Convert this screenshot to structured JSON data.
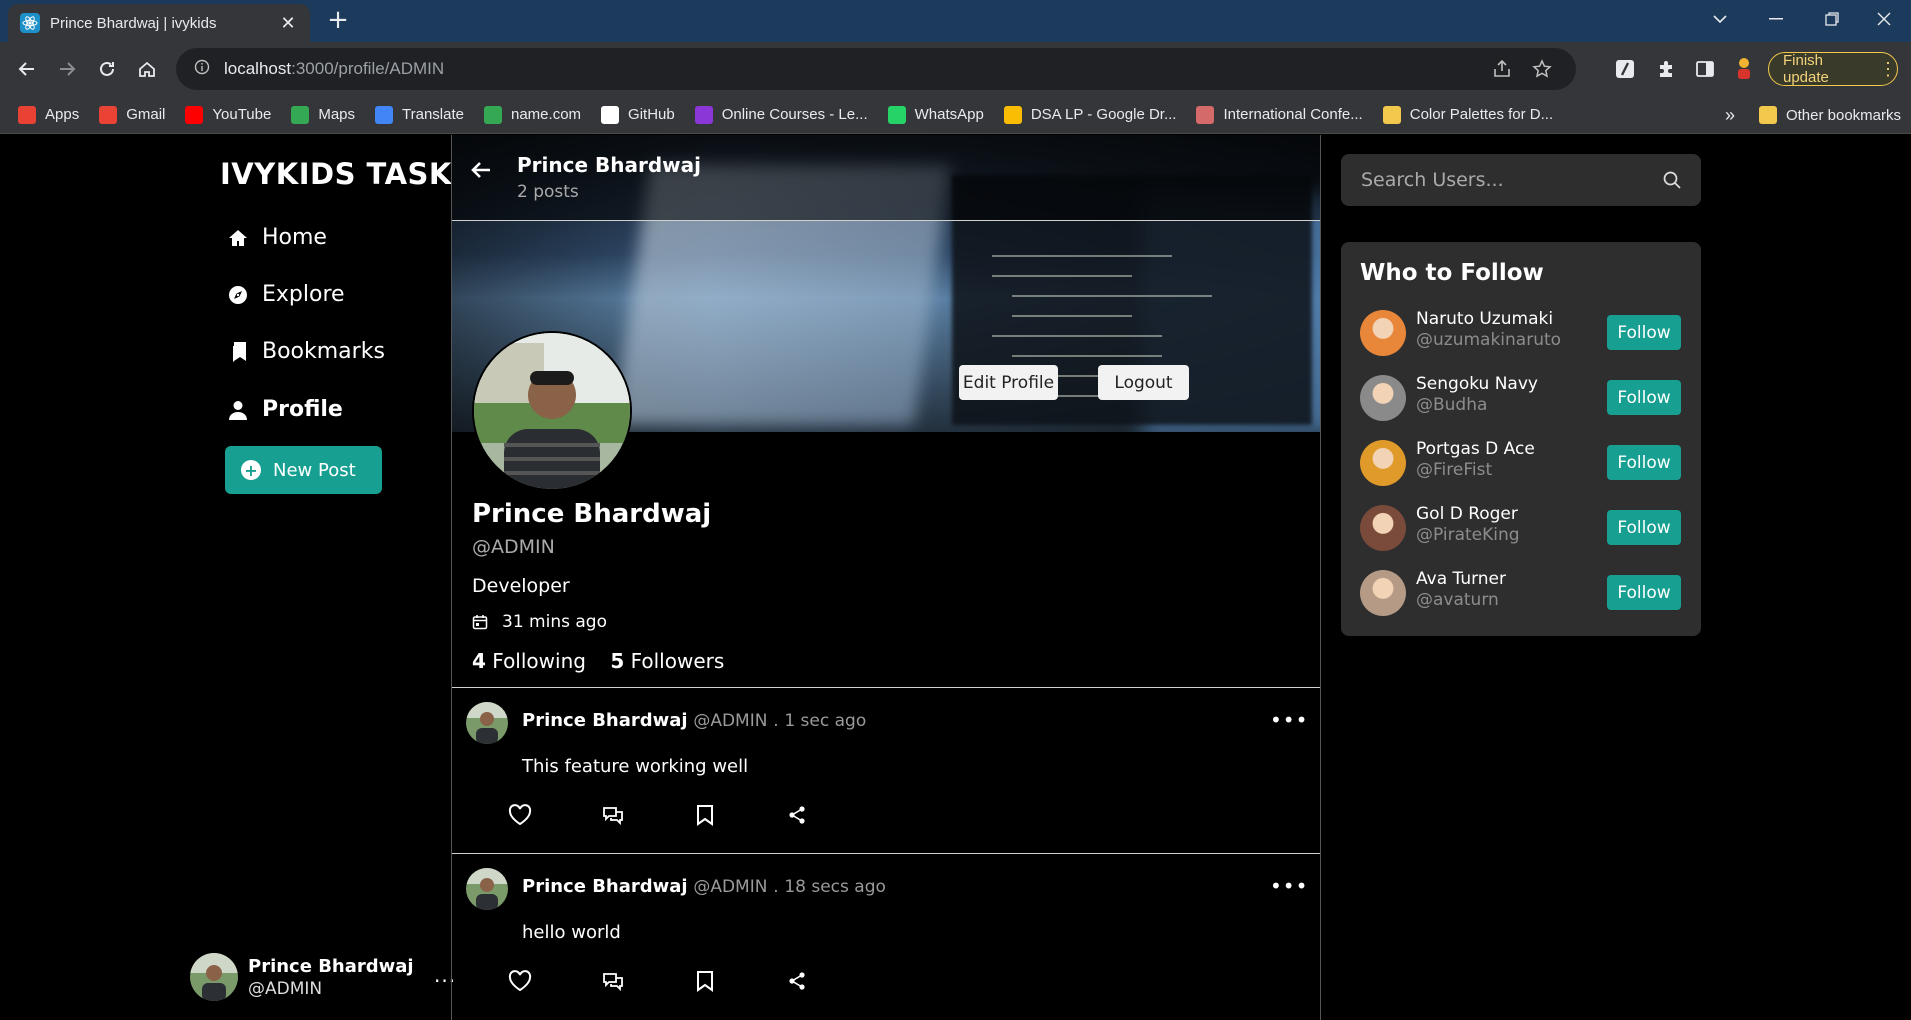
{
  "browser": {
    "tab_title": "Prince Bhardwaj | ivykids",
    "url_host": "localhost",
    "url_path": ":3000/profile/ADMIN",
    "finish_update_label": "Finish update",
    "bookmarks": [
      {
        "label": "Apps",
        "icon": "apps-grid-icon",
        "color": "#e94235"
      },
      {
        "label": "Gmail",
        "icon": "gmail-icon",
        "color": "#ea4335"
      },
      {
        "label": "YouTube",
        "icon": "youtube-icon",
        "color": "#ff0000"
      },
      {
        "label": "Maps",
        "icon": "maps-icon",
        "color": "#34a853"
      },
      {
        "label": "Translate",
        "icon": "translate-icon",
        "color": "#4285f4"
      },
      {
        "label": "name.com",
        "icon": "namecom-icon",
        "color": "#34a853"
      },
      {
        "label": "GitHub",
        "icon": "github-icon",
        "color": "#ffffff"
      },
      {
        "label": "Online Courses - Le...",
        "icon": "courses-icon",
        "color": "#8b36d6"
      },
      {
        "label": "WhatsApp",
        "icon": "whatsapp-icon",
        "color": "#25d366"
      },
      {
        "label": "DSA LP - Google Dr...",
        "icon": "drive-icon",
        "color": "#fbbc04"
      },
      {
        "label": "International Confe...",
        "icon": "brush-icon",
        "color": "#d46a6a"
      },
      {
        "label": "Color Palettes for D...",
        "icon": "palette-icon",
        "color": "#f2c94c"
      }
    ],
    "other_bookmarks": "Other bookmarks",
    "overflow": "»"
  },
  "app": {
    "brand": "IVYKIDS TASK",
    "nav": [
      {
        "label": "Home",
        "icon": "home-icon"
      },
      {
        "label": "Explore",
        "icon": "compass-icon"
      },
      {
        "label": "Bookmarks",
        "icon": "bookmarks-icon"
      },
      {
        "label": "Profile",
        "icon": "person-icon",
        "active": true
      }
    ],
    "new_post_label": "New Post",
    "current_user": {
      "name": "Prince Bhardwaj",
      "handle": "@ADMIN",
      "more": "..."
    },
    "accent_color": "#17a091"
  },
  "profile": {
    "header_name": "Prince Bhardwaj",
    "header_posts": "2 posts",
    "name": "Prince Bhardwaj",
    "handle": "@ADMIN",
    "bio": "Developer",
    "joined": "31 mins ago",
    "following_count": "4",
    "following_label": "Following",
    "followers_count": "5",
    "followers_label": "Followers",
    "edit_profile_label": "Edit Profile",
    "logout_label": "Logout"
  },
  "posts": [
    {
      "name": "Prince Bhardwaj",
      "handle": "@ADMIN",
      "sep": ".",
      "time": "1 sec ago",
      "text": "This feature working well"
    },
    {
      "name": "Prince Bhardwaj",
      "handle": "@ADMIN",
      "sep": ".",
      "time": "18 secs ago",
      "text": "hello world"
    }
  ],
  "search": {
    "placeholder": "Search Users..."
  },
  "who_to_follow": {
    "title": "Who to Follow",
    "follow_label": "Follow",
    "users": [
      {
        "name": "Naruto Uzumaki",
        "handle": "@uzumakinaruto",
        "avatar_color": "#e8873a"
      },
      {
        "name": "Sengoku Navy",
        "handle": "@Budha",
        "avatar_color": "#8a8a8a"
      },
      {
        "name": "Portgas D Ace",
        "handle": "@FireFist",
        "avatar_color": "#e09a2a"
      },
      {
        "name": "Gol D Roger",
        "handle": "@PirateKing",
        "avatar_color": "#7a4a3a"
      },
      {
        "name": "Ava Turner",
        "handle": "@avaturn",
        "avatar_color": "#b59a86"
      }
    ]
  }
}
